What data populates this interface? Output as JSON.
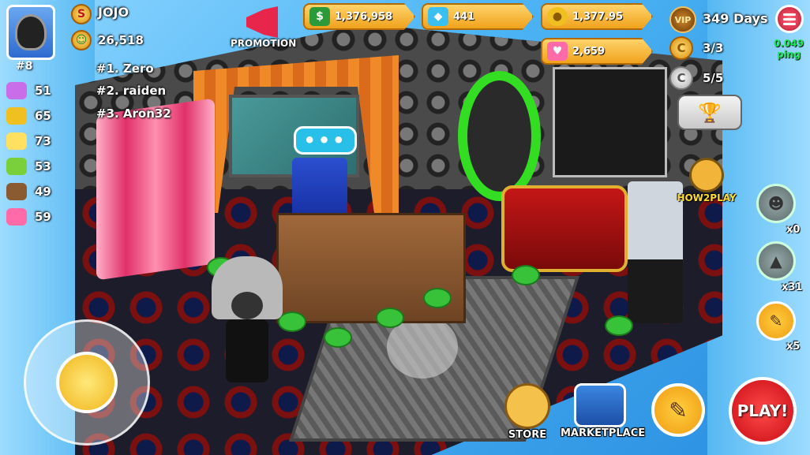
{
  "player": {
    "name": "JOJO",
    "score": "26,518",
    "rank": "#8"
  },
  "leaderboard": [
    "#1. Zero",
    "#2. raiden",
    "#3. Aron32"
  ],
  "stats": [
    {
      "icon": "flower-icon",
      "value": "51",
      "color": "#c96ee8"
    },
    {
      "icon": "crown-icon",
      "value": "65",
      "color": "#f0c020"
    },
    {
      "icon": "bulb-icon",
      "value": "73",
      "color": "#ffe060"
    },
    {
      "icon": "leaf-icon",
      "value": "53",
      "color": "#7ad03a"
    },
    {
      "icon": "cake-icon",
      "value": "49",
      "color": "#8a5a30"
    },
    {
      "icon": "heart-icon",
      "value": "59",
      "color": "#ff6aa8"
    }
  ],
  "promotion": {
    "label": "PROMOTION"
  },
  "currencies": {
    "cash": "1,376,958",
    "diamonds": "441",
    "gold": "1,377.95",
    "hearts": "2,659"
  },
  "status": {
    "vip": "VIP",
    "days": "349 Days",
    "ping_value": "0.049",
    "ping_label": "ping",
    "coin_c_gold": "3/3",
    "coin_c_silver": "5/5"
  },
  "chat_bubble": "•••",
  "how2play": "HOW2PLAY",
  "side_counts": {
    "ghost": "x0",
    "poop": "x31",
    "brush": "x5"
  },
  "bottom": {
    "store": "STORE",
    "marketplace": "MARKETPLACE",
    "play": "PLAY!"
  },
  "colors": {
    "accent_gold": "#f0a21c",
    "play_red": "#c80c14",
    "ping_green": "#19e85a"
  }
}
